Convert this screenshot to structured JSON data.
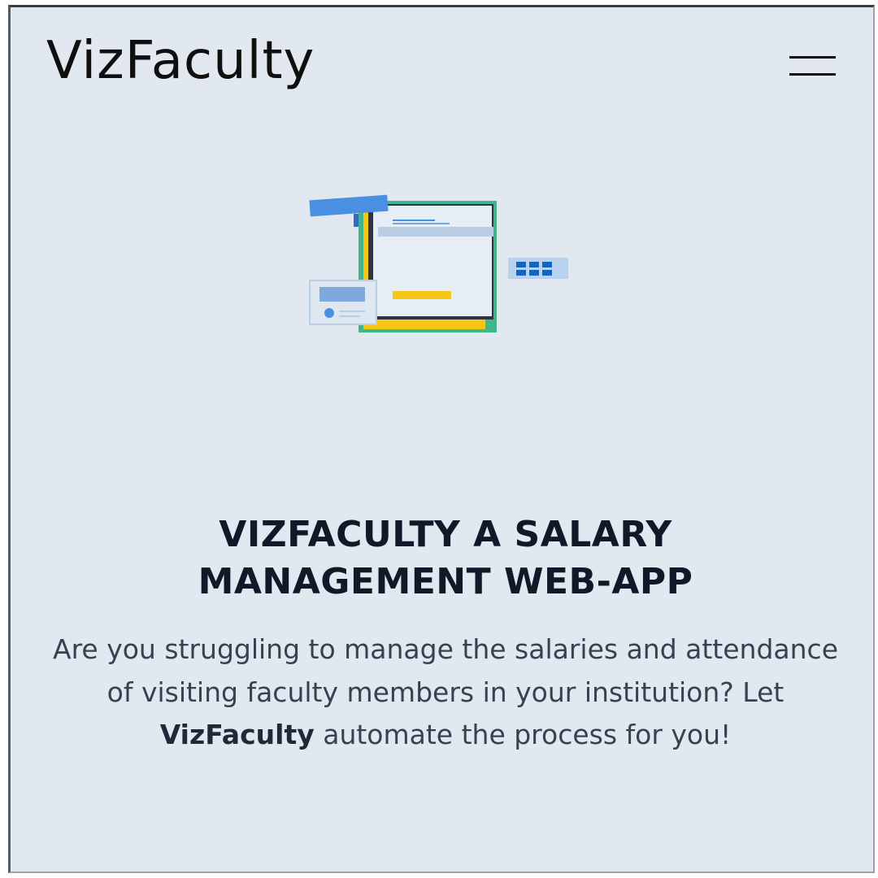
{
  "navbar": {
    "brand": "VizFaculty",
    "menu_icon": "hamburger-menu-icon"
  },
  "hero": {
    "illustration_icon": "salary-document-illustration",
    "headline_line1": "VIZFACULTY A SALARY",
    "headline_line2": "MANAGEMENT WEB-APP",
    "description_part1": "Are you struggling to manage the salaries and attendance of visiting faculty members in your institution? Let ",
    "description_brand": "VizFaculty",
    "description_part2": " automate the process for you!"
  },
  "colors": {
    "background": "#e2e8f0",
    "accent_blue": "#4a90e2",
    "accent_green": "#3fb68b",
    "accent_yellow": "#f5c518"
  }
}
